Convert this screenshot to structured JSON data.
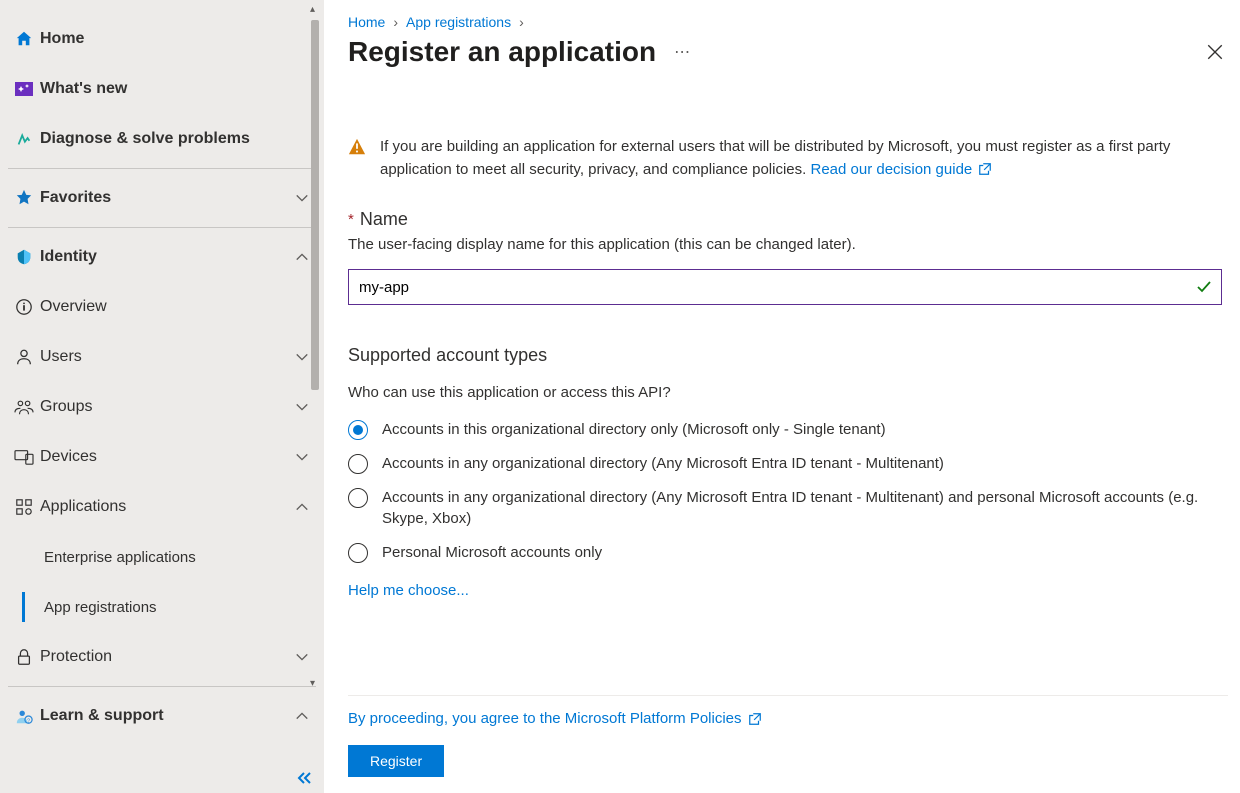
{
  "sidebar": {
    "items": [
      {
        "label": "Home",
        "bold": true
      },
      {
        "label": "What's new",
        "bold": true
      },
      {
        "label": "Diagnose & solve problems",
        "bold": true
      }
    ],
    "favorites_label": "Favorites",
    "identity_label": "Identity",
    "identity_items": [
      {
        "label": "Overview"
      },
      {
        "label": "Users"
      },
      {
        "label": "Groups"
      },
      {
        "label": "Devices"
      },
      {
        "label": "Applications"
      }
    ],
    "applications_sub": [
      {
        "label": "Enterprise applications"
      },
      {
        "label": "App registrations"
      }
    ],
    "protection_label": "Protection",
    "learn_label": "Learn & support"
  },
  "breadcrumb": {
    "home": "Home",
    "appreg": "App registrations"
  },
  "page_title": "Register an application",
  "warning": {
    "text": "If you are building an application for external users that will be distributed by Microsoft, you must register as a first party application to meet all security, privacy, and compliance policies. ",
    "link_text": "Read our decision guide"
  },
  "name_field": {
    "label": "Name",
    "help": "The user-facing display name for this application (this can be changed later).",
    "value": "my-app"
  },
  "account_types": {
    "heading": "Supported account types",
    "subtext": "Who can use this application or access this API?",
    "options": [
      "Accounts in this organizational directory only (Microsoft only - Single tenant)",
      "Accounts in any organizational directory (Any Microsoft Entra ID tenant - Multitenant)",
      "Accounts in any organizational directory (Any Microsoft Entra ID tenant - Multitenant) and personal Microsoft accounts (e.g. Skype, Xbox)",
      "Personal Microsoft accounts only"
    ],
    "help_me_choose": "Help me choose..."
  },
  "footer": {
    "policy_text": "By proceeding, you agree to the Microsoft Platform Policies",
    "register": "Register"
  }
}
